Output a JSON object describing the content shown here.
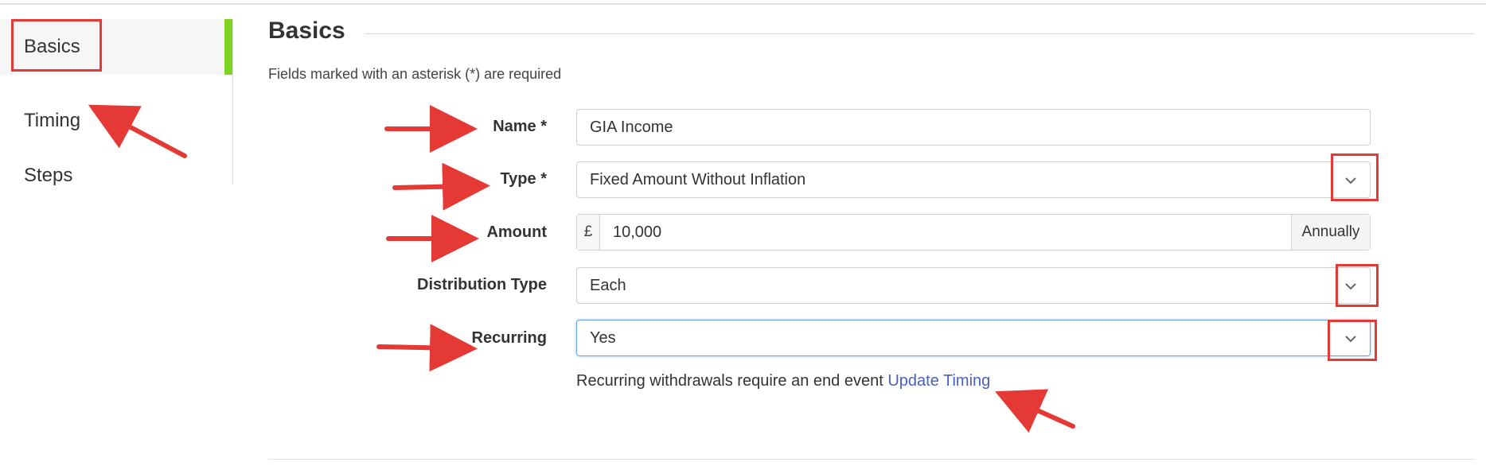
{
  "sidebar": {
    "items": [
      {
        "label": "Basics",
        "active": true
      },
      {
        "label": "Timing",
        "active": false
      },
      {
        "label": "Steps",
        "active": false
      }
    ],
    "active_color": "#7ed321"
  },
  "main": {
    "title": "Basics",
    "required_note": "Fields marked with an asterisk (*) are required",
    "fields": {
      "name": {
        "label": "Name *",
        "value": "GIA Income"
      },
      "type": {
        "label": "Type *",
        "value": "Fixed Amount Without Inflation"
      },
      "amount": {
        "label": "Amount",
        "currency": "£",
        "value": "10,000",
        "frequency": "Annually"
      },
      "distribution_type": {
        "label": "Distribution Type",
        "value": "Each"
      },
      "recurring": {
        "label": "Recurring",
        "value": "Yes"
      }
    },
    "help": {
      "text": "Recurring withdrawals require an end event",
      "link": "Update Timing"
    }
  },
  "annotations": {
    "color": "#e53935",
    "arrow_icon": "red-arrow-icon",
    "highlight_box": "red-highlight-box"
  }
}
